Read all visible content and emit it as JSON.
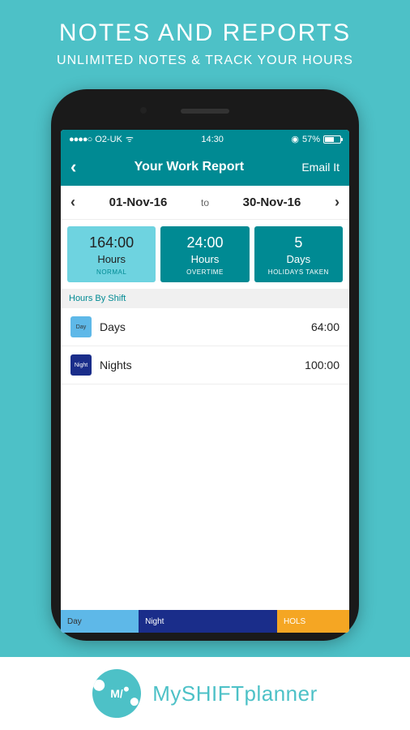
{
  "promo": {
    "title": "NOTES AND REPORTS",
    "subtitle": "UNLIMITED NOTES & TRACK YOUR HOURS"
  },
  "statusBar": {
    "signal": "●●●●○",
    "carrier": "O2-UK",
    "wifi": "ᯤ",
    "time": "14:30",
    "batteryIcon": "◉",
    "batteryPercent": "57%"
  },
  "nav": {
    "back": "‹",
    "title": "Your Work Report",
    "action": "Email It"
  },
  "dateRange": {
    "prevArrow": "‹",
    "start": "01-Nov-16",
    "to": "to",
    "end": "30-Nov-16",
    "nextArrow": "›"
  },
  "summary": {
    "normal": {
      "value": "164:00",
      "unit": "Hours",
      "label": "NORMAL"
    },
    "overtime": {
      "value": "24:00",
      "unit": "Hours",
      "label": "OVERTIME"
    },
    "holidays": {
      "value": "5",
      "unit": "Days",
      "label": "HOLIDAYS TAKEN"
    }
  },
  "sectionHeader": "Hours By Shift",
  "shifts": [
    {
      "badge": "Day",
      "name": "Days",
      "hours": "64:00"
    },
    {
      "badge": "Night",
      "name": "Nights",
      "hours": "100:00"
    }
  ],
  "legend": {
    "day": "Day",
    "night": "Night",
    "hols": "HOLS"
  },
  "brand": {
    "logoText": "M/",
    "name_prefix": "My",
    "name_bold": "SHIFT",
    "name_suffix": "planner"
  }
}
